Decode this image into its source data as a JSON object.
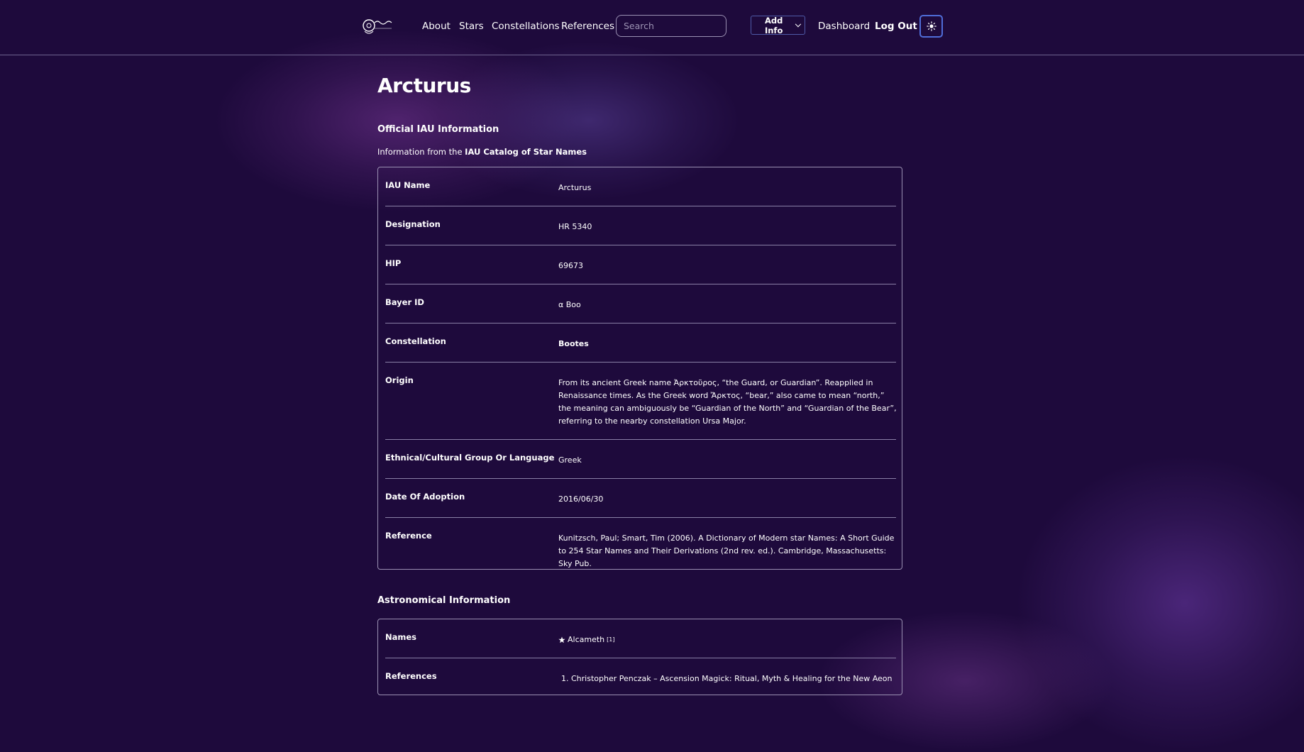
{
  "nav": {
    "about": "About",
    "stars": "Stars",
    "constellations": "Constellations",
    "references": "References",
    "search_placeholder": "Search",
    "add_info": "Add Info",
    "dashboard": "Dashboard",
    "log_out": "Log Out",
    "theme_icon": "sun-icon"
  },
  "page": {
    "title": "Arcturus"
  },
  "iau": {
    "section_title": "Official IAU Information",
    "intro_prefix": "Information from the ",
    "intro_link": "IAU Catalog of Star Names",
    "rows": [
      {
        "label": "IAU Name",
        "value": "Arcturus"
      },
      {
        "label": "Designation",
        "value": "HR 5340"
      },
      {
        "label": "HIP",
        "value": "69673"
      },
      {
        "label": "Bayer ID",
        "value": "α Boo"
      },
      {
        "label": "Constellation",
        "value": "Bootes"
      },
      {
        "label": "Origin",
        "value": "From its ancient Greek name Ἀρκτοῦρος, “the Guard, or Guardian”. Reapplied in Renaissance times. As the Greek word Ἄρκτος, “bear,” also came to mean “north,” the meaning can ambiguously be “Guardian of the North” and “Guardian of the Bear”, referring to the nearby constellation Ursa Major."
      },
      {
        "label": "Ethnical/Cultural Group Or Language",
        "value": "Greek"
      },
      {
        "label": "Date Of Adoption",
        "value": "2016/06/30"
      },
      {
        "label": "Reference",
        "value": "Kunitzsch, Paul; Smart, Tim (2006). A Dictionary of Modern star Names: A Short Guide to 254 Star Names and Their Derivations (2nd rev. ed.). Cambridge, Massachusetts: Sky Pub."
      }
    ]
  },
  "astro": {
    "section_title": "Astronomical Information",
    "names_label": "Names",
    "name_value": "Alcameth",
    "name_ref": "[1]",
    "references_label": "References",
    "reference_number": "1.",
    "reference_text": "Christopher Penczak – Ascension Magick: Ritual, Myth & Healing for the New Aeon"
  },
  "colors": {
    "background": "#1e0a3c",
    "border": "#9a90b2",
    "accent_border": "#4f6dd8"
  }
}
